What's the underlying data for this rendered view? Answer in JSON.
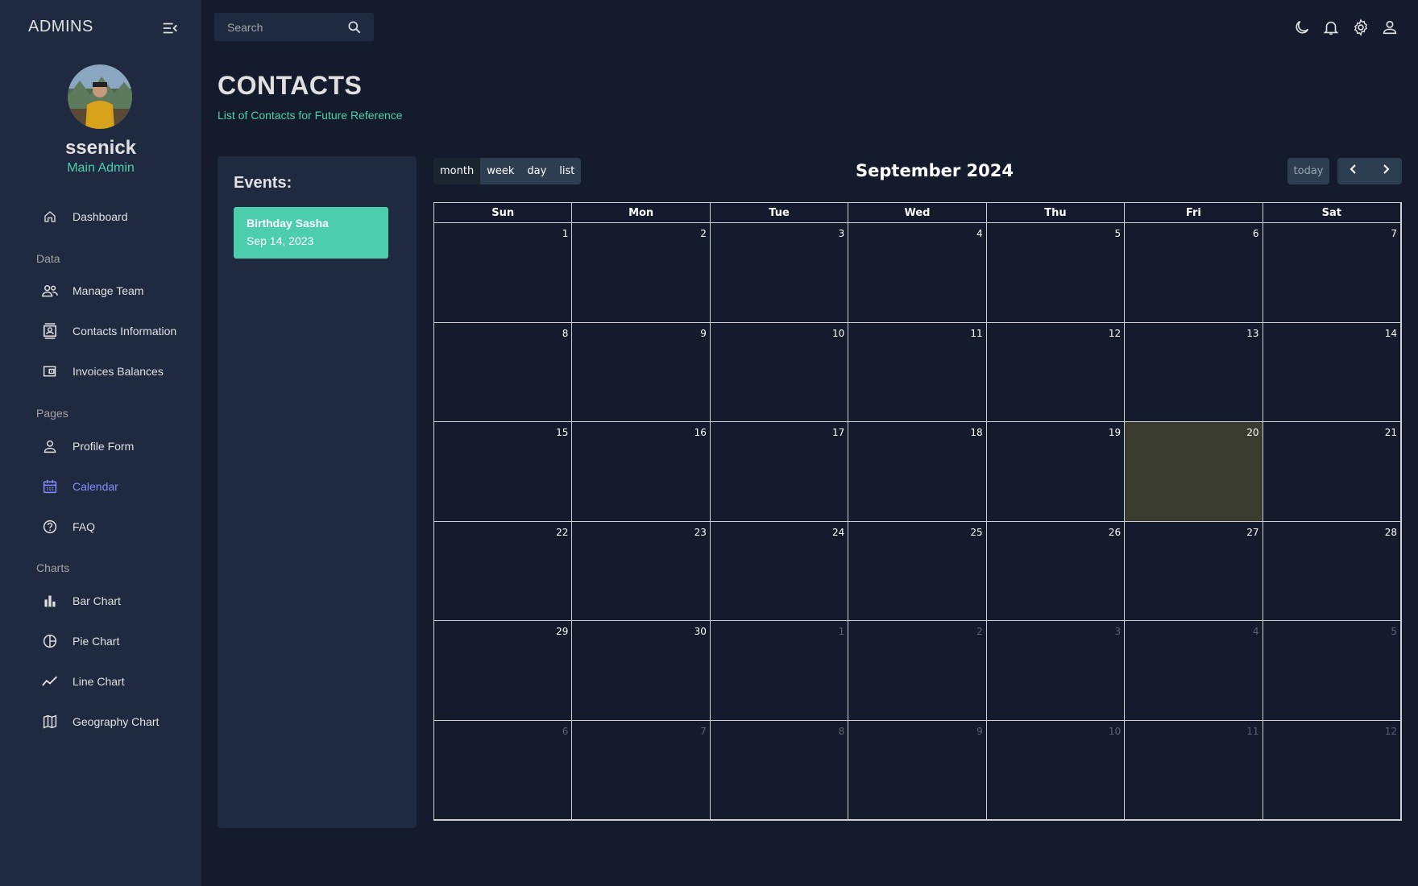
{
  "sidebar": {
    "brand": "ADMINS",
    "user": {
      "name": "ssenick",
      "role": "Main Admin"
    },
    "items": [
      {
        "label": "Dashboard",
        "icon": "home-icon"
      },
      {
        "label": "Manage Team",
        "icon": "people-icon"
      },
      {
        "label": "Contacts Information",
        "icon": "contacts-icon"
      },
      {
        "label": "Invoices Balances",
        "icon": "receipt-icon"
      },
      {
        "label": "Profile Form",
        "icon": "person-icon"
      },
      {
        "label": "Calendar",
        "icon": "calendar-icon",
        "active": true
      },
      {
        "label": "FAQ",
        "icon": "help-icon"
      },
      {
        "label": "Bar Chart",
        "icon": "bar-chart-icon"
      },
      {
        "label": "Pie Chart",
        "icon": "pie-chart-icon"
      },
      {
        "label": "Line Chart",
        "icon": "line-chart-icon"
      },
      {
        "label": "Geography Chart",
        "icon": "map-icon"
      }
    ],
    "sections": [
      "Data",
      "Pages",
      "Charts"
    ]
  },
  "topbar": {
    "search_placeholder": "Search",
    "icons": [
      "dark-mode-icon",
      "notifications-icon",
      "settings-icon",
      "user-icon"
    ]
  },
  "header": {
    "title": "CONTACTS",
    "subtitle": "List of Contacts for Future Reference"
  },
  "events": {
    "title": "Events:",
    "items": [
      {
        "title": "Birthday Sasha",
        "date": "Sep 14, 2023"
      }
    ]
  },
  "calendar": {
    "title": "September 2024",
    "views": [
      "month",
      "week",
      "day",
      "list"
    ],
    "active_view": "month",
    "today_label": "today",
    "weekdays": [
      "Sun",
      "Mon",
      "Tue",
      "Wed",
      "Thu",
      "Fri",
      "Sat"
    ],
    "weeks": [
      [
        "1",
        "2",
        "3",
        "4",
        "5",
        "6",
        "7"
      ],
      [
        "8",
        "9",
        "10",
        "11",
        "12",
        "13",
        "14"
      ],
      [
        "15",
        "16",
        "17",
        "18",
        "19",
        "20",
        "21"
      ],
      [
        "22",
        "23",
        "24",
        "25",
        "26",
        "27",
        "28"
      ],
      [
        "29",
        "30",
        "1",
        "2",
        "3",
        "4",
        "5"
      ],
      [
        "6",
        "7",
        "8",
        "9",
        "10",
        "11",
        "12"
      ]
    ],
    "today_day": "20",
    "accent_color": "#4cceac",
    "active_nav_color": "#868dfb"
  }
}
